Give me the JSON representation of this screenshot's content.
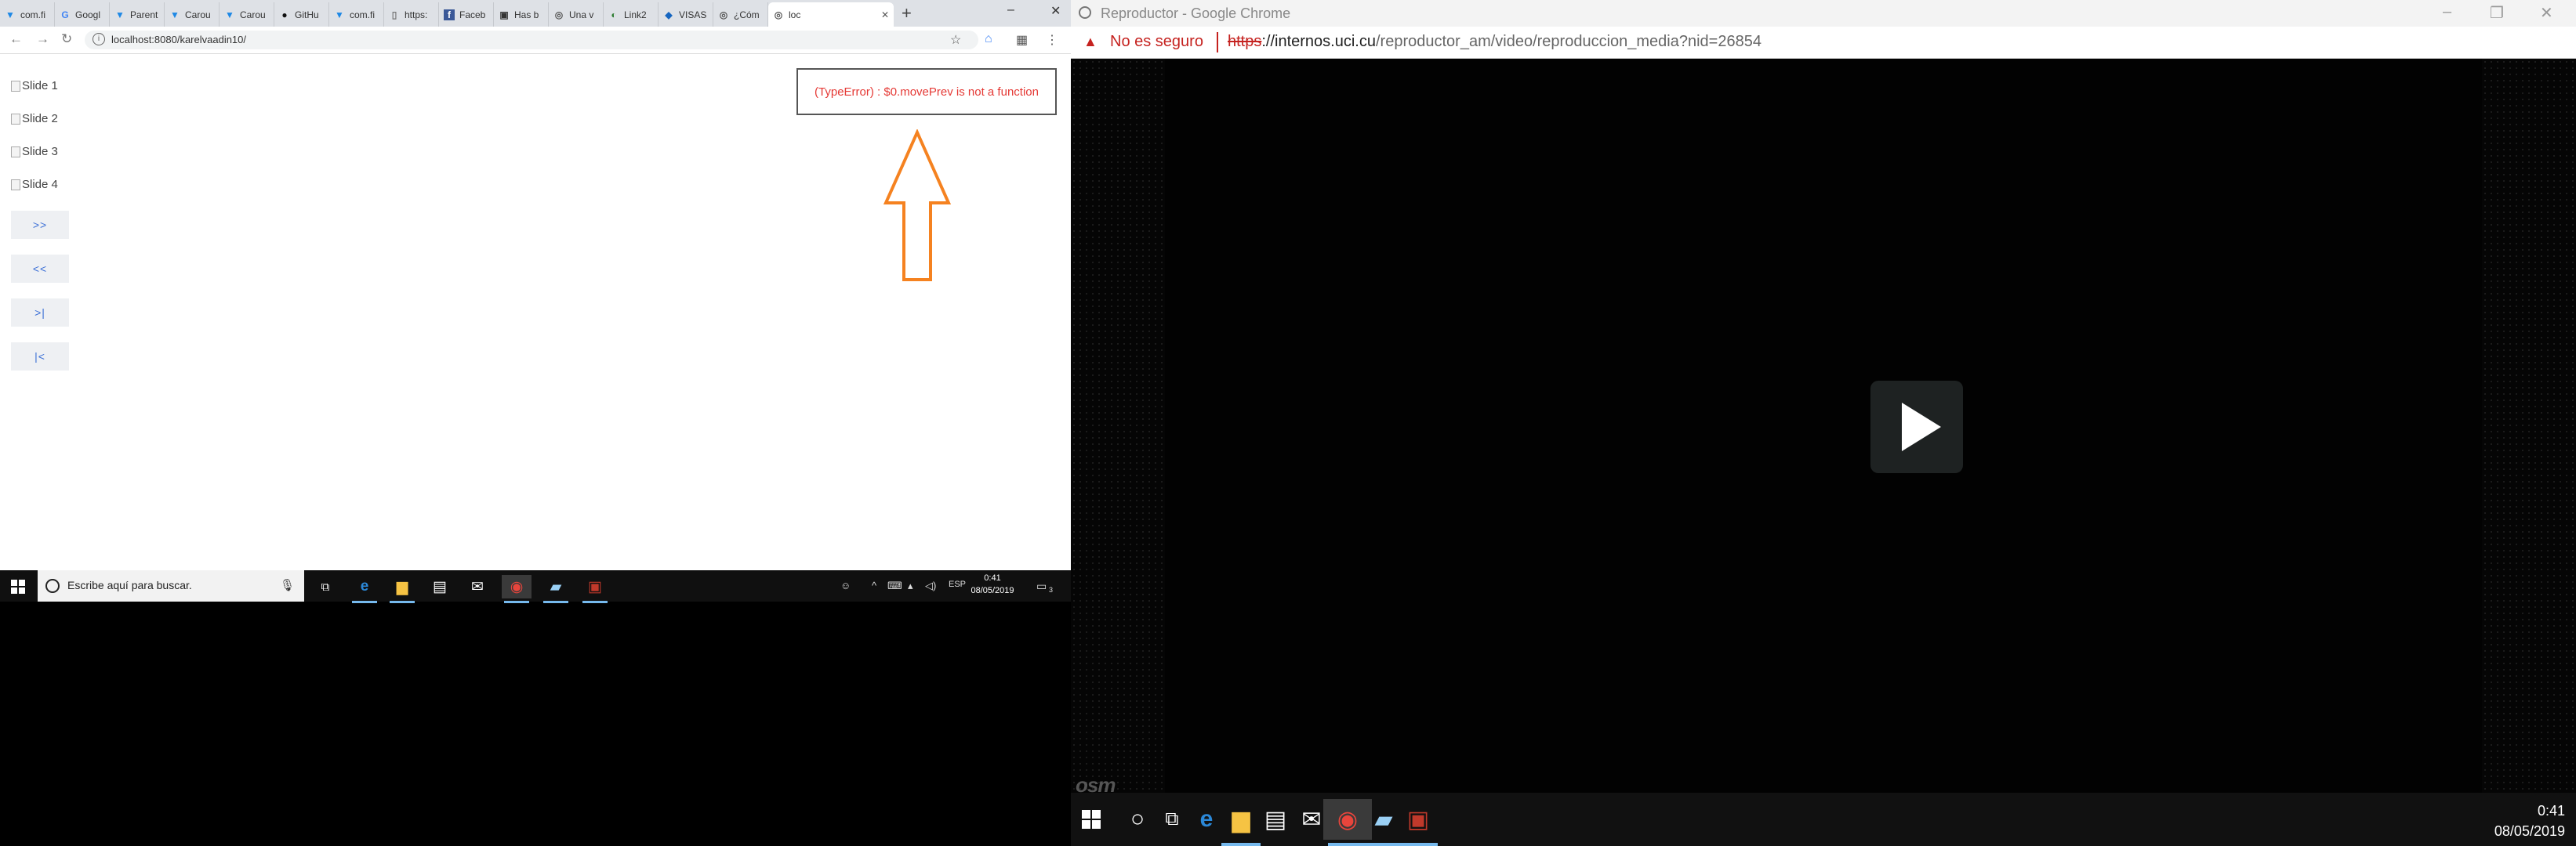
{
  "left_browser": {
    "tabs": [
      {
        "label": "com.fi"
      },
      {
        "label": "Googl"
      },
      {
        "label": "Parent"
      },
      {
        "label": "Carou"
      },
      {
        "label": "Carou"
      },
      {
        "label": "GitHu"
      },
      {
        "label": "com.fi"
      },
      {
        "label": "https:"
      },
      {
        "label": "Faceb"
      },
      {
        "label": "Has b"
      },
      {
        "label": "Una v"
      },
      {
        "label": "Link2"
      },
      {
        "label": "VISAS"
      },
      {
        "label": "¿Cóm"
      },
      {
        "label": "loc"
      }
    ],
    "new_tab_label": "+",
    "url": "localhost:8080/karelvaadin10/"
  },
  "page": {
    "slides": [
      "Slide 1",
      "Slide 2",
      "Slide 3",
      "Slide 4"
    ],
    "buttons": {
      "next": ">>",
      "prev": "<<",
      "last": ">|",
      "first": "|<"
    },
    "error_message": "(TypeError) : $0.movePrev is not a function"
  },
  "left_taskbar": {
    "search_placeholder": "Escribe aquí para buscar.",
    "language": "ESP",
    "time": "0:41",
    "date": "08/05/2019",
    "notification_count": "3"
  },
  "right_browser": {
    "window_title": "Reproductor - Google Chrome",
    "security_warning": "No es seguro",
    "url_scheme": "https",
    "url_host": "://internos.uci.cu",
    "url_path": "/reproductor_am/video/reproduccion_media?nid=26854",
    "watermark": "osm"
  },
  "right_taskbar": {
    "time": "0:41",
    "date": "08/05/2019"
  },
  "colors": {
    "error_text": "#e53935",
    "arrow": "#f58220",
    "button_text": "#3b6fd6",
    "taskbar_accent": "#76b9ed",
    "insecure": "#c5221f"
  }
}
